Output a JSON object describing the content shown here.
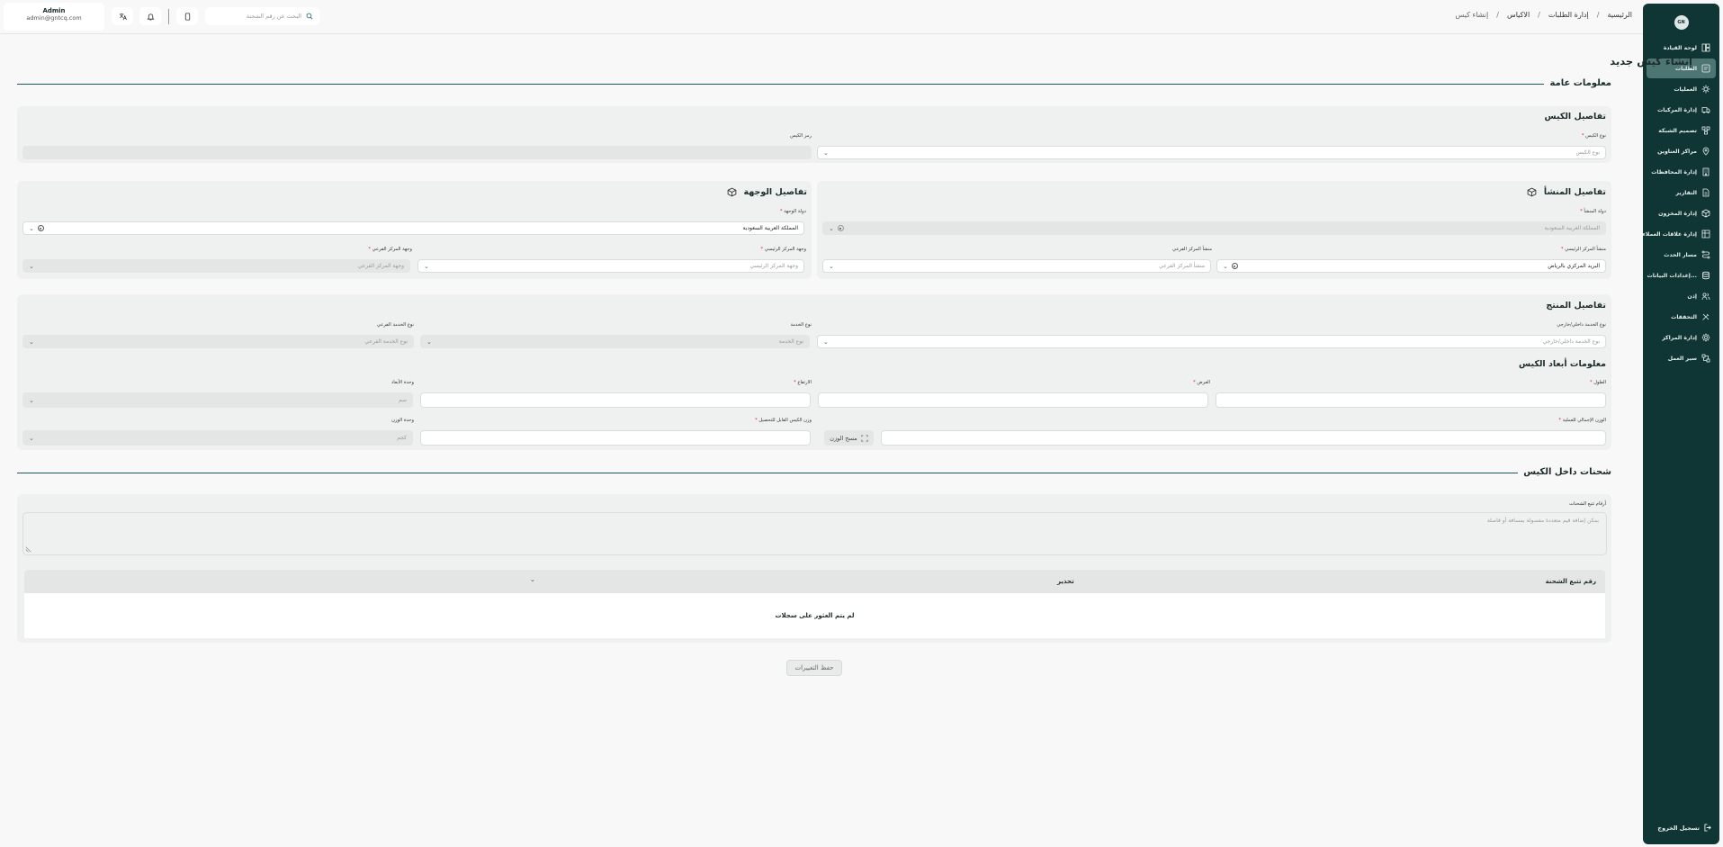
{
  "sidebar": {
    "logo": "GN",
    "items": [
      {
        "label": "لوحة القيادة",
        "icon": "dashboard-icon"
      },
      {
        "label": "الطلبات",
        "icon": "orders-icon"
      },
      {
        "label": "العمليات",
        "icon": "operations-icon"
      },
      {
        "label": "إدارة المركبات",
        "icon": "truck-icon"
      },
      {
        "label": "تصميم الشبكة",
        "icon": "network-icon"
      },
      {
        "label": "مراكز العناوين",
        "icon": "location-icon"
      },
      {
        "label": "إدارة المحافظات",
        "icon": "building-icon"
      },
      {
        "label": "التقارير",
        "icon": "report-icon"
      },
      {
        "label": "إدارة المخزون",
        "icon": "inventory-icon"
      },
      {
        "label": "إدارة علاقات العملاء",
        "icon": "crm-icon"
      },
      {
        "label": "مسار الحدث",
        "icon": "route-icon"
      },
      {
        "label": "إعدادات البيانات...",
        "icon": "database-icon"
      },
      {
        "label": "إذن",
        "icon": "users-icon"
      },
      {
        "label": "التحققات",
        "icon": "tools-icon"
      },
      {
        "label": "إدارة المراكز",
        "icon": "settings-icon"
      },
      {
        "label": "سير العمل",
        "icon": "workflow-icon"
      }
    ],
    "active_index": 1,
    "logout": "تسجيل الخروج"
  },
  "header": {
    "breadcrumb": [
      "الرئيسية",
      "إدارة الطلبات",
      "الاكياس",
      "إنشاء كيس"
    ],
    "search_placeholder": "البحث عن رقم الشحنة",
    "user_name": "Admin",
    "user_email": "admin@gntcq.com"
  },
  "page": {
    "title": "إنشاء كيس جديد",
    "general_section": "معلومات عامة",
    "bag_details": {
      "title": "تفاصيل الكيس",
      "bag_type_label": "نوع الكيس",
      "bag_type_placeholder": "نوع الكيس",
      "bag_code_label": "رمز الكيس"
    },
    "origin": {
      "title": "تفاصيل المنشأ",
      "country_label": "دولة المنشأ",
      "country_value": "المملكة العربية السعودية",
      "main_hub_label": "منشأ المركز الرئيسي",
      "main_hub_value": "البريد المركزي بالرياض",
      "sub_hub_label": "منشأ المركز الفرعي",
      "sub_hub_placeholder": "منشأ المركز الفرعي"
    },
    "destination": {
      "title": "تفاصيل الوجهة",
      "country_label": "دولة الوجهة",
      "country_value": "المملكة العربية السعودية",
      "main_hub_label": "وجهة المركز الرئيسي",
      "main_hub_placeholder": "وجهة المركز الرئيسي",
      "sub_hub_label": "وجهة المركز الفرعي",
      "sub_hub_placeholder": "وجهة المركز الفرعي"
    },
    "product": {
      "title": "تفاصيل المنتج",
      "service_scope_label": "نوع الخدمة داخلي/خارجي",
      "service_scope_placeholder": "نوع الخدمة داخلي/خارجي",
      "service_type_label": "نوع الخدمة",
      "service_type_placeholder": "نوع الخدمة",
      "sub_service_label": "نوع الخدمة الفرعي",
      "sub_service_placeholder": "نوع الخدمة الفرعي"
    },
    "dimensions": {
      "title": "معلومات أبعاد الكيس",
      "length_label": "الطول",
      "width_label": "العرض",
      "height_label": "الارتفاع",
      "dim_unit_label": "وحدة الأبعاد",
      "dim_unit_value": "سم",
      "gross_weight_label": "الوزن الإجمالي للعملية",
      "scan_weight_button": "مسح الوزن",
      "chargeable_weight_label": "وزن الكيس القابل للتحصيل",
      "weight_unit_label": "وحدة الوزن",
      "weight_unit_value": "كجم"
    },
    "shipments": {
      "section": "شحنات داخل الكيس",
      "tracking_label": "أرقام تتبع الشحنات",
      "tracking_placeholder": "يمكن إضافة قيم متعددة مفصولة بمسافة أو فاصلة",
      "col_tracking": "رقم تتبع الشحنة",
      "col_warning": "تحذير",
      "empty": "لم يتم العثور على سجلات"
    },
    "save_button": "حفظ التغييرات"
  }
}
